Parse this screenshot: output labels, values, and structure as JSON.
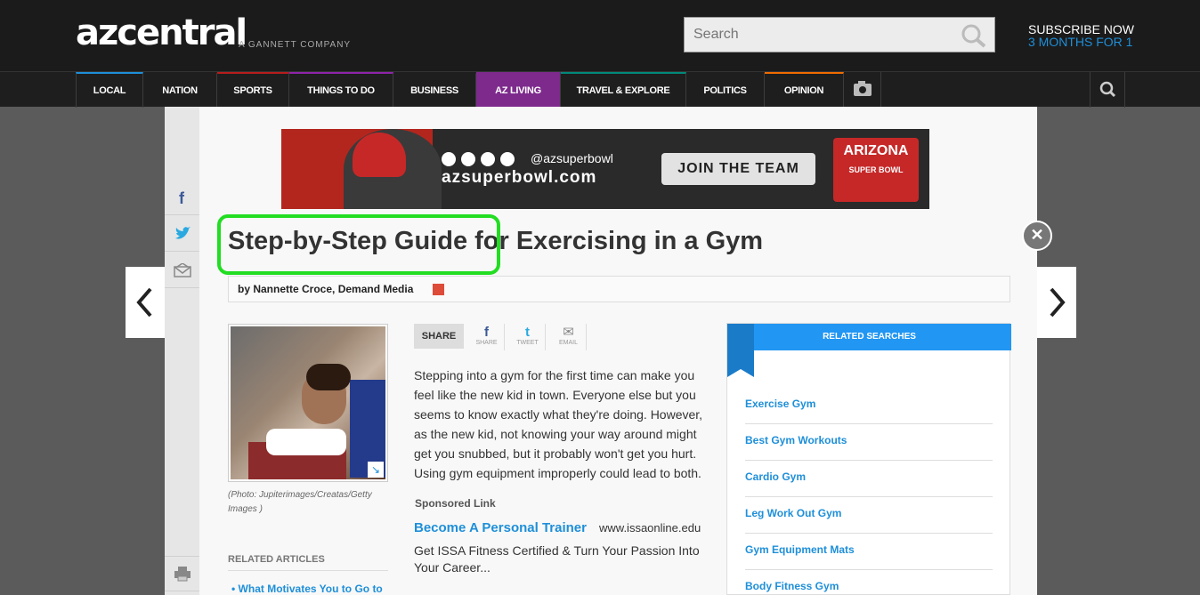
{
  "header": {
    "logo": "azcentral",
    "company": "A GANNETT COMPANY",
    "search_placeholder": "Search",
    "subscribe_line1": "SUBSCRIBE NOW",
    "subscribe_line2": "3 MONTHS FOR 1"
  },
  "nav": {
    "items": [
      {
        "label": "LOCAL"
      },
      {
        "label": "NATION"
      },
      {
        "label": "SPORTS"
      },
      {
        "label": "THINGS TO DO"
      },
      {
        "label": "BUSINESS"
      },
      {
        "label": "AZ LIVING"
      },
      {
        "label": "TRAVEL & EXPLORE"
      },
      {
        "label": "POLITICS"
      },
      {
        "label": "OPINION"
      }
    ],
    "active": "AZ LIVING",
    "active_color": "#7d2a8c"
  },
  "ad": {
    "handle": "@azsuperbowl",
    "url": "azsuperbowl.com",
    "cta": "JOIN THE TEAM",
    "badge_line1": "ARIZONA",
    "badge_line2": "SUPER BOWL"
  },
  "article": {
    "title": "Step-by-Step Guide for Exercising in a Gym",
    "byline": "by Nannette Croce, Demand Media",
    "photo_credit": "(Photo: Jupiterimages/Creatas/Getty Images )",
    "share_label": "SHARE",
    "share_items": [
      {
        "icon": "f",
        "label": "SHARE"
      },
      {
        "icon": "t",
        "label": "TWEET"
      },
      {
        "icon": "✉",
        "label": "EMAIL"
      }
    ],
    "body": "Stepping into a gym for the first time can make you feel like the new kid in town. Everyone else but you seems to know exactly what they're doing. However, as the new kid, not knowing your way around might get you snubbed, but it probably won't get you hurt. Using gym equipment improperly could lead to both.",
    "sponsored_label": "Sponsored Link",
    "sponsor_title": "Become A Personal Trainer",
    "sponsor_url": "www.issaonline.edu",
    "sponsor_desc": "Get ISSA Fitness Certified & Turn Your Passion Into Your Career...",
    "related_articles_label": "RELATED ARTICLES",
    "related_article_first": "What Motivates You to Go to"
  },
  "related_searches": {
    "header": "RELATED SEARCHES",
    "items": [
      "Exercise Gym",
      "Best Gym Workouts",
      "Cardio Gym",
      "Leg Work Out Gym",
      "Gym Equipment Mats",
      "Body Fitness Gym"
    ]
  },
  "highlight_color": "#22dd22"
}
